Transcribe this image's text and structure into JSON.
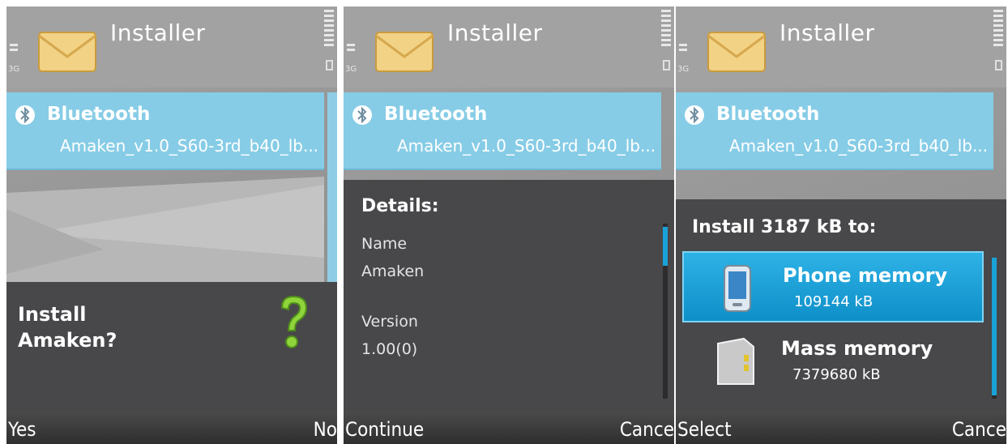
{
  "app": {
    "title": "Installer",
    "network": "3G"
  },
  "message": {
    "sender": "Bluetooth",
    "filename": "Amaken_v1.0_S60-3rd_b40_lb..."
  },
  "screen1": {
    "question_line1": "Install",
    "question_line2": "Amaken?",
    "softkeys": {
      "left": "Yes",
      "right": "No"
    }
  },
  "screen2": {
    "heading": "Details:",
    "name_label": "Name",
    "name_value": "Amaken",
    "version_label": "Version",
    "version_value": "1.00(0)",
    "softkeys": {
      "left": "Continue",
      "right": "Cance"
    }
  },
  "screen3": {
    "heading": "Install 3187 kB to:",
    "options": [
      {
        "name": "Phone memory",
        "size": "109144 kB",
        "selected": true
      },
      {
        "name": "Mass memory",
        "size": "7379680 kB",
        "selected": false
      }
    ],
    "softkeys": {
      "left": "Select",
      "right": "Cance"
    }
  },
  "colors": {
    "highlight": "#86cce6",
    "popup": "#48474a",
    "selected_option": "#1a9fd6",
    "scrollbar": "#1aa2d8"
  }
}
